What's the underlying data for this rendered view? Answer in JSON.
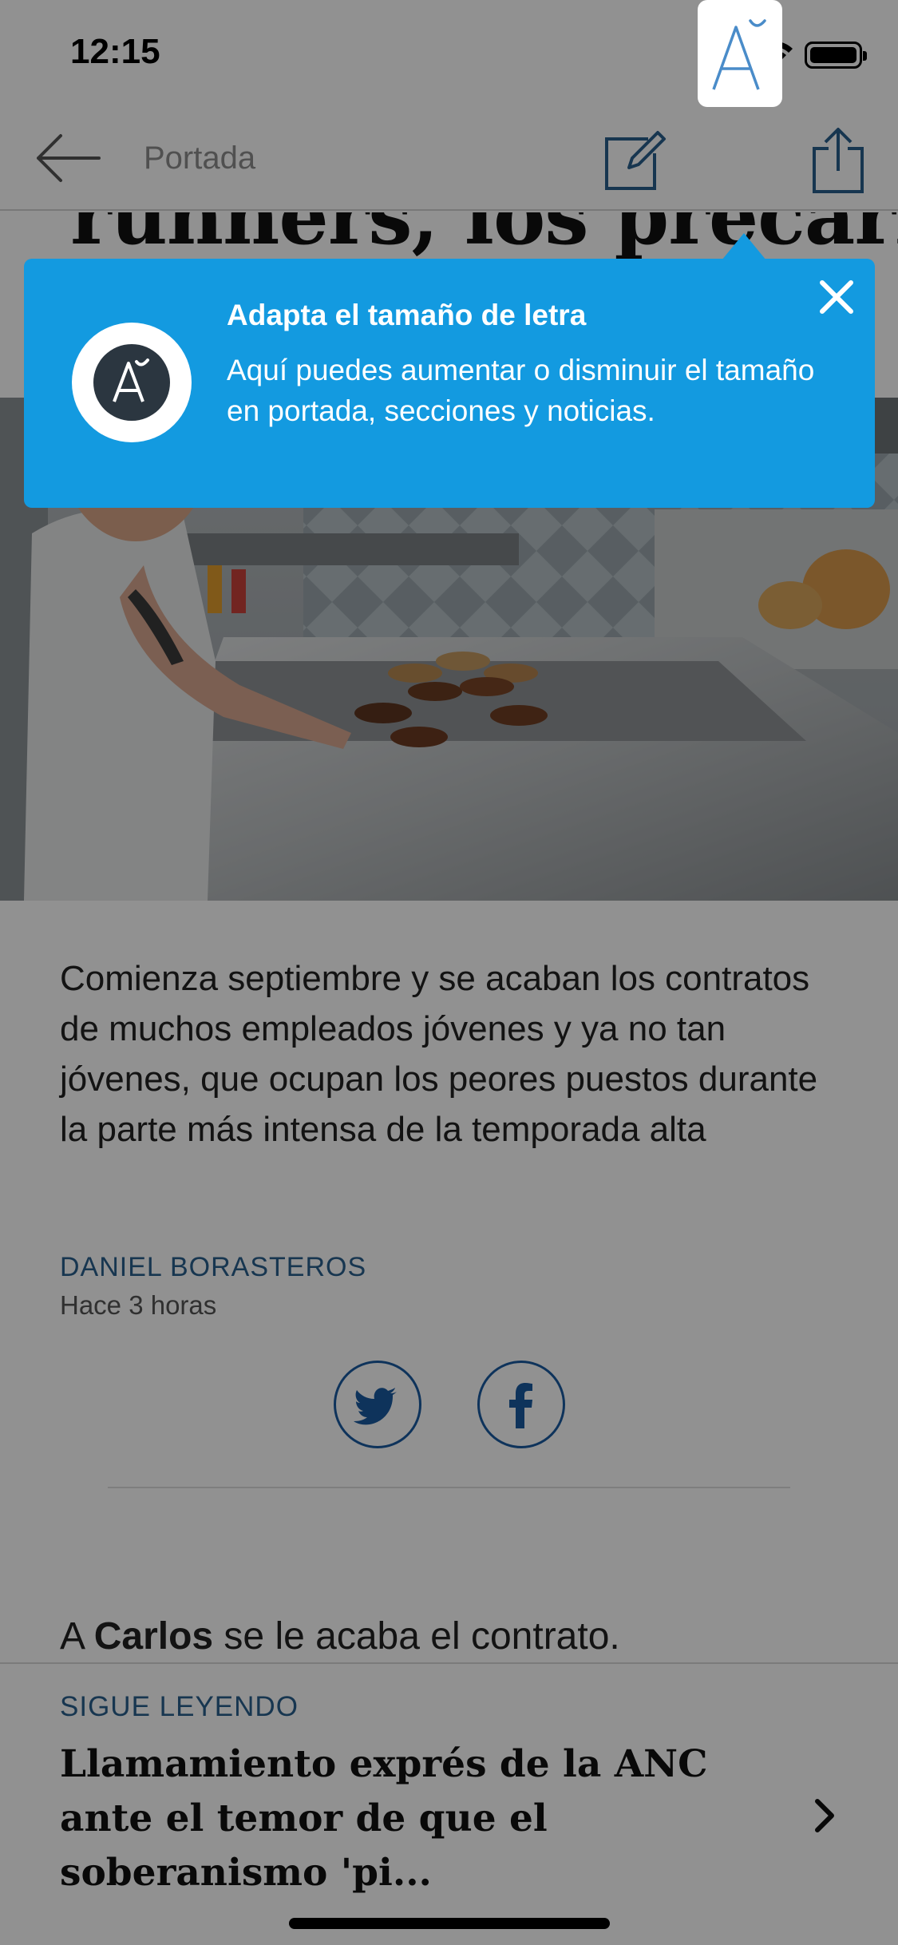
{
  "status_bar": {
    "time": "12:15"
  },
  "nav": {
    "title": "Portada",
    "icons": [
      "back-arrow-icon",
      "compose-icon",
      "font-size-icon",
      "share-icon"
    ]
  },
  "article": {
    "headline_fragment": "runners, los precarios de",
    "lead": "Comienza septiembre y se acaban los contratos de muchos empleados jóvenes y ya no tan jóvenes, que ocupan los peores puestos durante la parte más intensa de la temporada alta",
    "author": "DANIEL BORASTEROS",
    "time_ago": "Hace 3 horas",
    "body_prefix": "A ",
    "body_name": "Carlos",
    "body_suffix": " se le acaba el contrato."
  },
  "share": {
    "icons": [
      "twitter-icon",
      "facebook-icon"
    ]
  },
  "tooltip": {
    "title": "Adapta el tamaño de letra",
    "body": "Aquí puedes aumentar o disminuir el tamaño en portada, secciones y noticias."
  },
  "read_next": {
    "kicker": "SIGUE LEYENDO",
    "title": "Llamamiento exprés de la ANC ante el temor de que el soberanismo 'pi..."
  },
  "colors": {
    "tooltip_bg": "#139ae0",
    "accent_blue": "#2a5f8e",
    "social_blue": "#1a5aa0"
  }
}
